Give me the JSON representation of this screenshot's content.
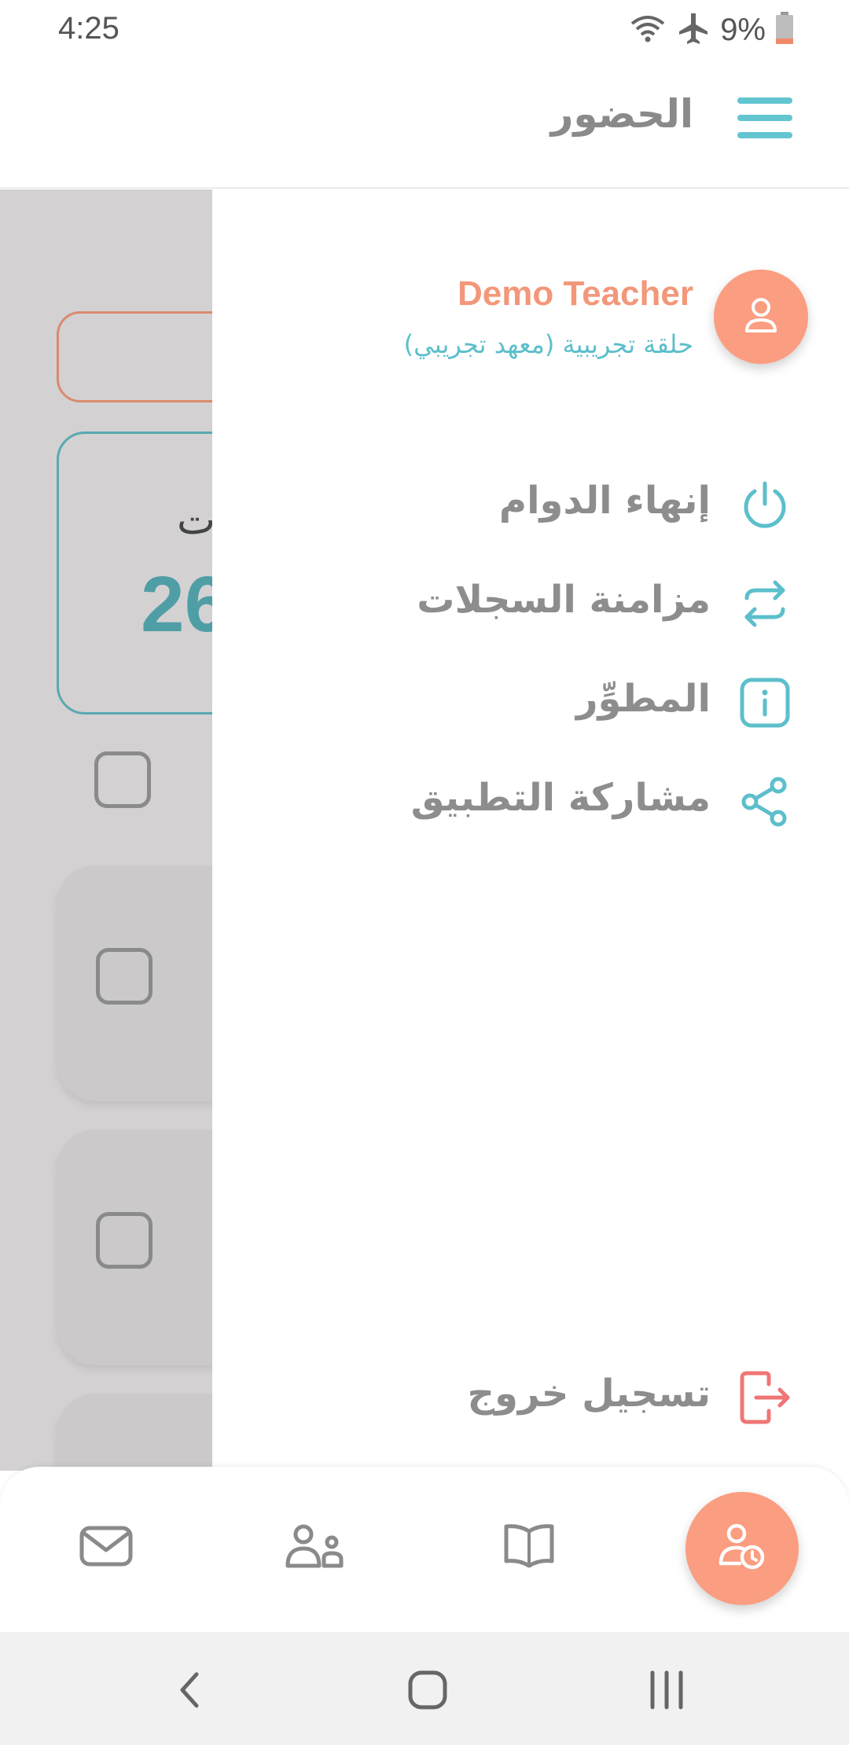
{
  "status_bar": {
    "time": "4:25",
    "battery_percent": "9%",
    "icons": [
      "wifi-icon",
      "airplane-icon",
      "battery-icon"
    ]
  },
  "app_bar": {
    "title": "الحضور",
    "menu_icon": "hamburger-menu-icon"
  },
  "background": {
    "card_label": "ت",
    "card_number": "26"
  },
  "drawer": {
    "user": {
      "name": "Demo Teacher",
      "subtitle": "حلقة تجريبية (معهد تجريبي)",
      "avatar_icon": "user-icon"
    },
    "items": [
      {
        "label": "إنهاء الدوام",
        "icon": "power-icon"
      },
      {
        "label": "مزامنة السجلات",
        "icon": "sync-icon"
      },
      {
        "label": "المطوِّر",
        "icon": "info-icon"
      },
      {
        "label": "مشاركة التطبيق",
        "icon": "share-icon"
      }
    ],
    "logout": {
      "label": "تسجيل خروج",
      "icon": "logout-icon"
    }
  },
  "bottom_nav": {
    "items": [
      "mail-icon",
      "users-icon",
      "book-icon",
      "attendance-icon"
    ]
  },
  "colors": {
    "accent_teal": "#5cbfcb",
    "accent_salmon": "#fb9d80",
    "logout_red": "#f07575",
    "text_gray": "#8d8d8d",
    "overlay": "#d3d1d2"
  }
}
